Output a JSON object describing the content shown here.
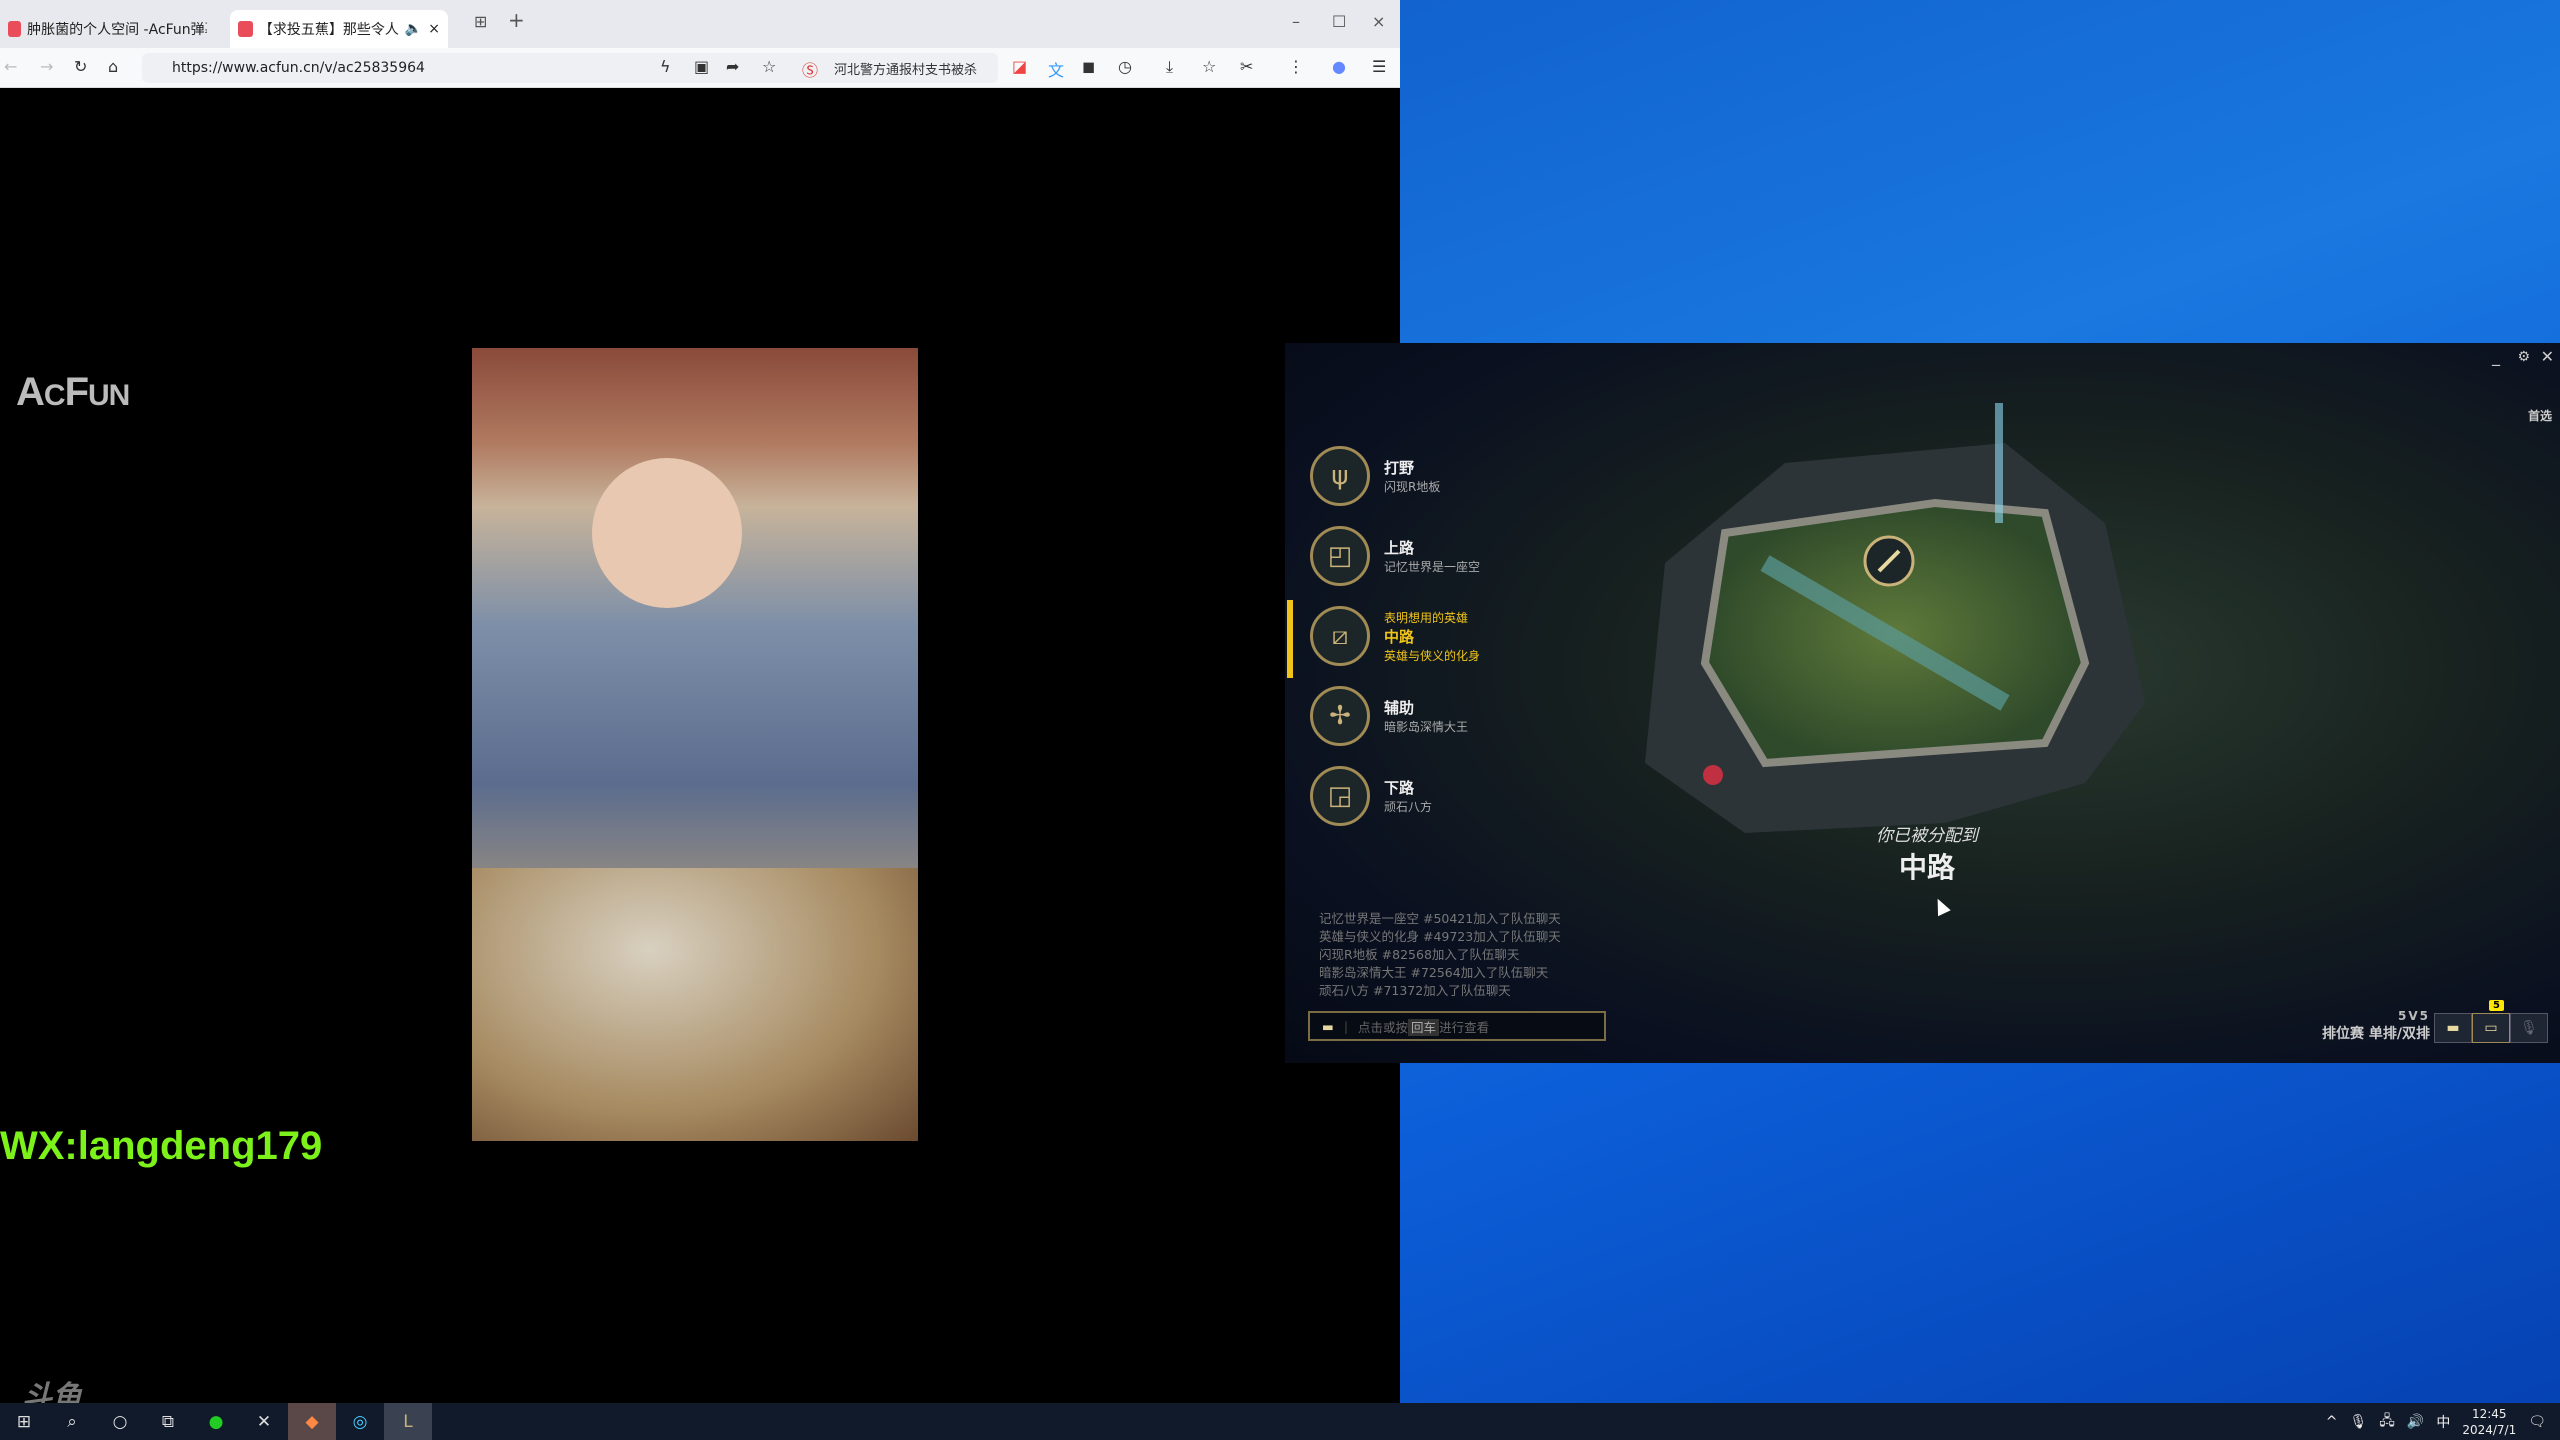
{
  "browser": {
    "tabs": [
      {
        "label": "肿胀菌的个人空间 -AcFun弹幕视频"
      },
      {
        "label": "【求投五蕉】那些令人心动",
        "active": true
      }
    ],
    "url": "https://www.acfun.cn/v/ac25835964",
    "news": "河北警方通报村支书被杀"
  },
  "video": {
    "logo": "ACFUN",
    "overlay": "WX:langdeng179",
    "watermark": "斗鱼"
  },
  "lol": {
    "preference": "首选",
    "roles": [
      {
        "name": "打野",
        "player": "闪现R地板",
        "icon": "jungle-icon"
      },
      {
        "name": "上路",
        "player": "记忆世界是一座空",
        "icon": "top-icon"
      },
      {
        "name": "中路",
        "player": "英雄与侠义的化身",
        "hint": "表明想用的英雄",
        "icon": "mid-icon",
        "selected": true
      },
      {
        "name": "辅助",
        "player": "暗影岛深情大王",
        "icon": "support-icon"
      },
      {
        "name": "下路",
        "player": "顽石八方",
        "icon": "bottom-icon"
      }
    ],
    "chat": [
      "记忆世界是一座空 #50421加入了队伍聊天",
      "英雄与侠义的化身 #49723加入了队伍聊天",
      "闪现R地板 #82568加入了队伍聊天",
      "暗影岛深情大王 #72564加入了队伍聊天",
      "顽石八方 #71372加入了队伍聊天"
    ],
    "chat_input": {
      "pre": "点击或按",
      "key": "回车",
      "post": "进行查看"
    },
    "assigned_label": "你已被分配到",
    "assigned_role": "中路",
    "mode": "5V5",
    "queue": "排位赛 单排/双排",
    "badge": "5",
    "accent": "#f0c419"
  },
  "taskbar": {
    "ime": "中",
    "time": "12:45",
    "date": "2024/7/1"
  }
}
